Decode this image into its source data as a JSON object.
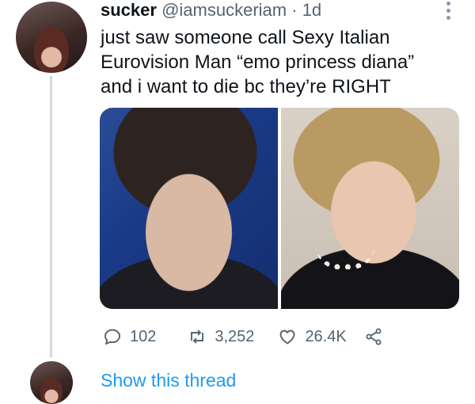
{
  "tweet": {
    "author_name": "sucker",
    "handle": "@iamsuckeriam",
    "separator": "·",
    "time": "1d",
    "text_lines": [
      "just saw someone call Sexy Italian",
      "Eurovision Man “emo princess diana”",
      "and i want to die bc they’re RIGHT"
    ],
    "media": [
      {
        "icon": "portrait-photo-man"
      },
      {
        "icon": "portrait-photo-woman"
      }
    ],
    "actions": {
      "reply_count": "102",
      "retweet_count": "3,252",
      "like_count": "26.4K",
      "reply_icon": "reply-icon",
      "retweet_icon": "retweet-icon",
      "like_icon": "heart-icon",
      "share_icon": "share-icon"
    }
  },
  "thread": {
    "show_label": "Show this thread"
  },
  "colors": {
    "link": "#1d9bf0",
    "secondary": "#536471",
    "text": "#0f1419",
    "thread_line": "#cfd9de"
  }
}
